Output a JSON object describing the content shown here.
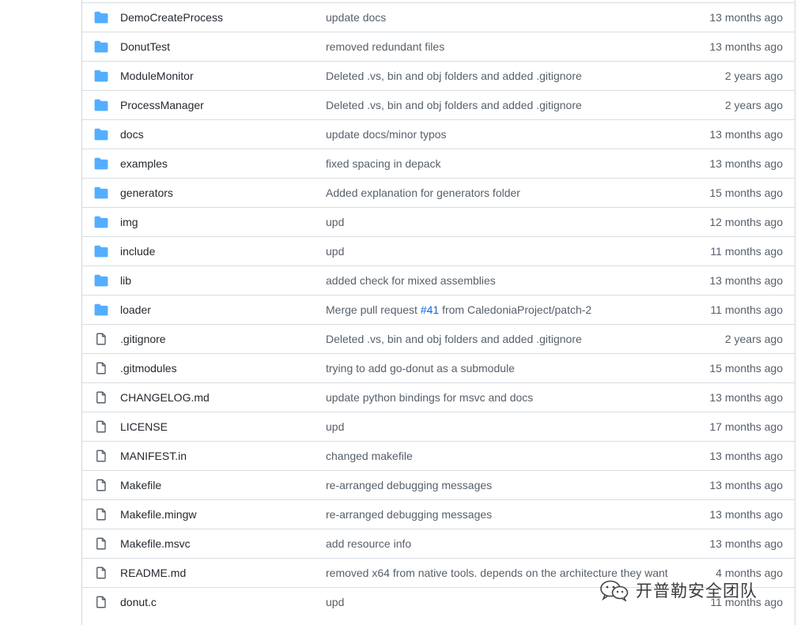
{
  "colors": {
    "folder_icon": "#54aeff",
    "file_icon": "#57606a",
    "link": "#0969da",
    "border": "#d0d7de"
  },
  "files": [
    {
      "type": "folder",
      "icon": "folder-icon",
      "name": "DemoCreateProcess",
      "message": "update docs",
      "age": "13 months ago"
    },
    {
      "type": "folder",
      "icon": "folder-icon",
      "name": "DonutTest",
      "message": "removed redundant files",
      "age": "13 months ago"
    },
    {
      "type": "folder",
      "icon": "folder-icon",
      "name": "ModuleMonitor",
      "message": "Deleted .vs, bin and obj folders and added .gitignore",
      "age": "2 years ago"
    },
    {
      "type": "folder",
      "icon": "folder-icon",
      "name": "ProcessManager",
      "message": "Deleted .vs, bin and obj folders and added .gitignore",
      "age": "2 years ago"
    },
    {
      "type": "folder",
      "icon": "folder-icon",
      "name": "docs",
      "message": "update docs/minor typos",
      "age": "13 months ago"
    },
    {
      "type": "folder",
      "icon": "folder-icon",
      "name": "examples",
      "message": "fixed spacing in depack",
      "age": "13 months ago"
    },
    {
      "type": "folder",
      "icon": "folder-icon",
      "name": "generators",
      "message": "Added explanation for generators folder",
      "age": "15 months ago"
    },
    {
      "type": "folder",
      "icon": "folder-icon",
      "name": "img",
      "message": "upd",
      "age": "12 months ago"
    },
    {
      "type": "folder",
      "icon": "folder-icon",
      "name": "include",
      "message": "upd",
      "age": "11 months ago"
    },
    {
      "type": "folder",
      "icon": "folder-icon",
      "name": "lib",
      "message": "added check for mixed assemblies",
      "age": "13 months ago"
    },
    {
      "type": "folder",
      "icon": "folder-icon",
      "name": "loader",
      "message_prefix": "Merge pull request ",
      "message_link": "#41",
      "message_suffix": " from CaledoniaProject/patch-2",
      "age": "11 months ago"
    },
    {
      "type": "file",
      "icon": "file-icon",
      "name": ".gitignore",
      "message": "Deleted .vs, bin and obj folders and added .gitignore",
      "age": "2 years ago"
    },
    {
      "type": "file",
      "icon": "file-icon",
      "name": ".gitmodules",
      "message": "trying to add go-donut as a submodule",
      "age": "15 months ago"
    },
    {
      "type": "file",
      "icon": "file-icon",
      "name": "CHANGELOG.md",
      "message": "update python bindings for msvc and docs",
      "age": "13 months ago"
    },
    {
      "type": "file",
      "icon": "file-icon",
      "name": "LICENSE",
      "message": "upd",
      "age": "17 months ago"
    },
    {
      "type": "file",
      "icon": "file-icon",
      "name": "MANIFEST.in",
      "message": "changed makefile",
      "age": "13 months ago"
    },
    {
      "type": "file",
      "icon": "file-icon",
      "name": "Makefile",
      "message": "re-arranged debugging messages",
      "age": "13 months ago"
    },
    {
      "type": "file",
      "icon": "file-icon",
      "name": "Makefile.mingw",
      "message": "re-arranged debugging messages",
      "age": "13 months ago"
    },
    {
      "type": "file",
      "icon": "file-icon",
      "name": "Makefile.msvc",
      "message": "add resource info",
      "age": "13 months ago"
    },
    {
      "type": "file",
      "icon": "file-icon",
      "name": "README.md",
      "message": "removed x64 from native tools. depends on the architecture they want",
      "age": "4 months ago"
    },
    {
      "type": "file",
      "icon": "file-icon",
      "name": "donut.c",
      "message": "upd",
      "age": "11 months ago"
    }
  ],
  "watermark": {
    "icon": "wechat-icon",
    "text": "开普勒安全团队"
  }
}
